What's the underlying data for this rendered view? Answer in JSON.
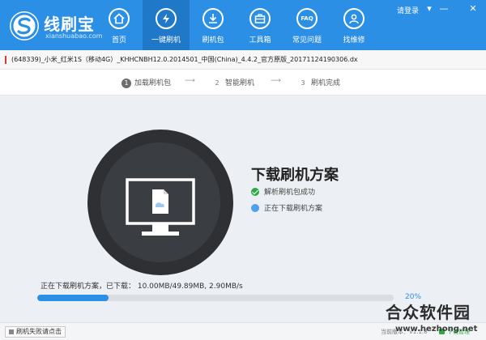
{
  "app": {
    "name": "线刷宝",
    "subtitle": "xianshuabao.com",
    "login_label": "请登录",
    "window_controls": {
      "menu": "▾",
      "minimize": "—",
      "close": "✕"
    }
  },
  "nav": {
    "items": [
      {
        "label": "首页",
        "icon": "home-icon",
        "glyph": "⌂",
        "active": false
      },
      {
        "label": "一键刷机",
        "icon": "lightning-icon",
        "glyph": "⚡",
        "active": true
      },
      {
        "label": "刷机包",
        "icon": "download-package-icon",
        "glyph": "⤓",
        "active": false
      },
      {
        "label": "工具箱",
        "icon": "toolbox-icon",
        "glyph": "▣",
        "active": false
      },
      {
        "label": "常见问题",
        "icon": "faq-icon",
        "glyph": "FAQ",
        "active": false
      },
      {
        "label": "找维修",
        "icon": "person-icon",
        "glyph": "☺",
        "active": false
      }
    ]
  },
  "file": {
    "path": "(648339)_小米_红米1S（移动4G）_KHHCNBH12.0.2014501_中国(China)_4.4.2_官方原版_20171124190306.dx"
  },
  "steps": [
    {
      "num": "1",
      "label": "加载刷机包",
      "done": true
    },
    {
      "num": "2",
      "label": "智能刷机",
      "done": false
    },
    {
      "num": "3",
      "label": "刷机完成",
      "done": false
    }
  ],
  "step_arrow": "⟶",
  "main": {
    "title": "下载刷机方案",
    "statuses": [
      {
        "text": "解析刷机包成功",
        "state": "ok"
      },
      {
        "text": "正在下载刷机方案",
        "state": "wait"
      }
    ],
    "progress_text": "正在下载刷机方案，已下载： 10.00MB/49.89MB,  2.90MB/s",
    "progress_percent_label": "20%",
    "progress_fraction": 0.2
  },
  "footer": {
    "fail_link": "刷机失败请点击",
    "version": "当前版本：V1.1.8",
    "manage": "下载管理"
  },
  "watermark": {
    "text": "合众软件园",
    "url": "www.hezhong.net"
  },
  "colors": {
    "brand": "#2b8fe6",
    "nav_active": "#1f78c8",
    "success": "#2eaa44",
    "progress": "#2c8fe6"
  }
}
